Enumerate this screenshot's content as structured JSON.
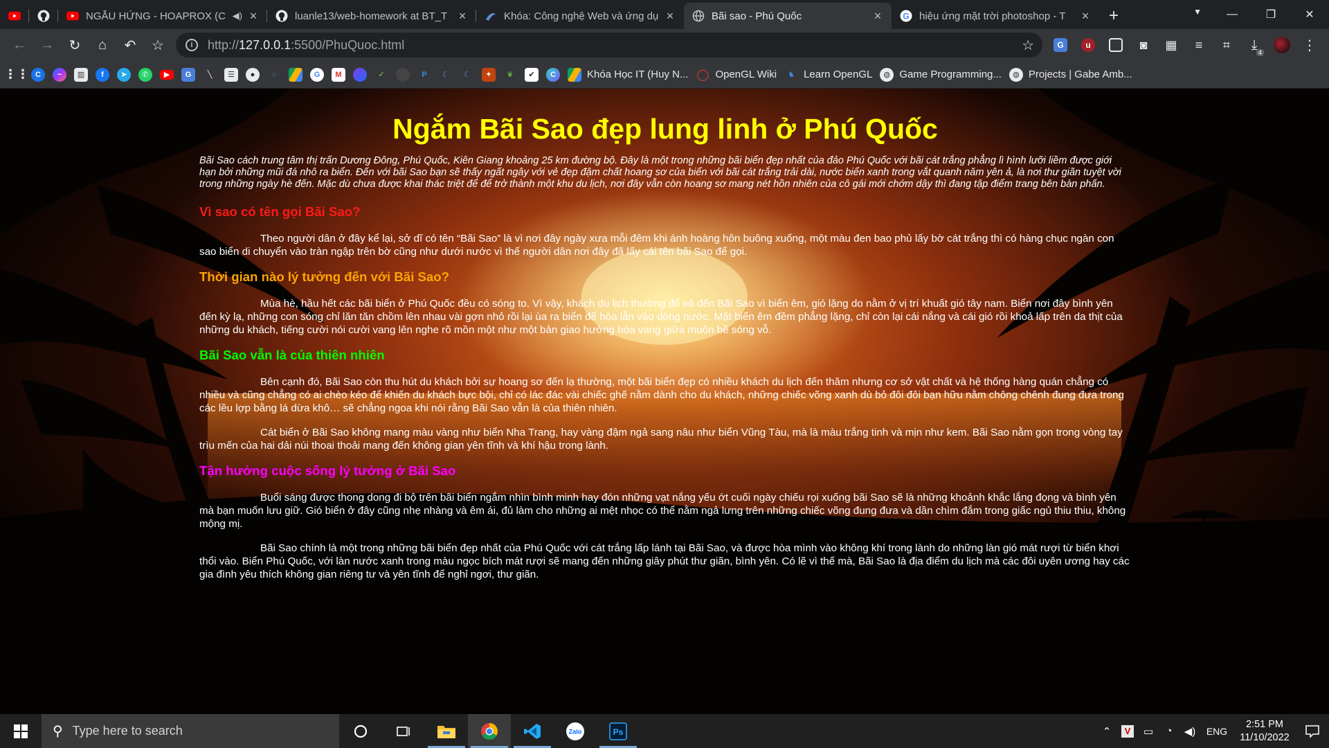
{
  "browser": {
    "tabs": [
      {
        "title": "",
        "icon": "youtube-icon",
        "pinned": true
      },
      {
        "title": "",
        "icon": "github-icon",
        "pinned": true
      },
      {
        "title": "NGẪU HỨNG - HOAPROX (C",
        "icon": "youtube-icon",
        "audio": "speaker-icon"
      },
      {
        "title": "luanle13/web-homework at BT_T",
        "icon": "github-icon"
      },
      {
        "title": "Khóa: Công nghệ Web và ứng dụ",
        "icon": "moodle-icon"
      },
      {
        "title": "Bãi sao - Phú Quốc",
        "icon": "globe-icon",
        "active": true
      },
      {
        "title": "hiệu ứng mặt trời photoshop - T",
        "icon": "google-icon"
      }
    ],
    "url_prefix": "http://",
    "url_host": "127.0.0.1",
    "url_rest": ":5500/PhuQuoc.html",
    "download_count": "4",
    "bookmarks": [
      {
        "label": "",
        "icon": "apps-grid-icon"
      },
      {
        "label": "",
        "icon": "c-icon"
      },
      {
        "label": "",
        "icon": "messenger-icon"
      },
      {
        "label": "",
        "icon": "trello-icon"
      },
      {
        "label": "",
        "icon": "facebook-icon"
      },
      {
        "label": "",
        "icon": "telegram-icon"
      },
      {
        "label": "",
        "icon": "whatsapp-icon"
      },
      {
        "label": "",
        "icon": "youtube-icon"
      },
      {
        "label": "",
        "icon": "translate-icon"
      },
      {
        "label": "",
        "icon": "pen-icon"
      },
      {
        "label": "",
        "icon": "stack-icon"
      },
      {
        "label": "",
        "icon": "github-icon"
      },
      {
        "label": "",
        "icon": "spinner-icon"
      },
      {
        "label": "",
        "icon": "drive-icon"
      },
      {
        "label": "",
        "icon": "google-icon"
      },
      {
        "label": "",
        "icon": "gmail-icon"
      },
      {
        "label": "",
        "icon": "orb-icon"
      },
      {
        "label": "",
        "icon": "chart-icon"
      },
      {
        "label": "",
        "icon": "circle-icon"
      },
      {
        "label": "",
        "icon": "paypal-icon"
      },
      {
        "label": "",
        "icon": "moodle-icon"
      },
      {
        "label": "",
        "icon": "moodle-icon"
      },
      {
        "label": "",
        "icon": "shield-icon"
      },
      {
        "label": "",
        "icon": "leaf-icon"
      },
      {
        "label": "",
        "icon": "check-icon"
      },
      {
        "label": "",
        "icon": "c-icon"
      },
      {
        "label": "Khóa Học IT (Huy N...",
        "icon": "drive-icon"
      },
      {
        "label": "OpenGL Wiki",
        "icon": "opengl-icon"
      },
      {
        "label": "Learn OpenGL",
        "icon": "learnopengl-icon"
      },
      {
        "label": "Game Programming...",
        "icon": "globe-icon"
      },
      {
        "label": "Projects | Gabe Amb...",
        "icon": "globe-icon"
      }
    ]
  },
  "page": {
    "title": "Ngắm Bãi Sao đẹp lung linh ở Phú Quốc",
    "intro": "Bãi Sao cách trung tâm thị trấn Dương Đông, Phú Quốc, Kiên Giang khoảng 25 km đường bộ. Đây là một trong những bãi biển đẹp nhất của đảo Phú Quốc với bãi cát trắng phẳng lì hình lưỡi liềm được giới hạn bởi những mũi đá nhô ra biển. Đến với bãi Sao bạn sẽ thấy ngất ngây với vẻ đẹp đậm chất hoang sơ của biển với bãi cát trắng trải dài, nước biển xanh trong vắt quanh năm yên ả, là nơi thư giãn tuyệt vời trong những ngày hè đến. Mặc dù chưa được khai thác triệt để để trở thành một khu du lịch, nơi đây vẫn còn hoang sơ mang nét hồn nhiên của cô gái mới chớm dậy thì đang tập điểm trang bên bàn phấn.",
    "sections": [
      {
        "heading": "Vì sao có tên gọi Bãi Sao?",
        "color": "#ff1a1a",
        "paragraphs": [
          "Theo người dân ở đây kể lại, sở dĩ có tên “Bãi Sao” là vì nơi đây ngày xưa mỗi đêm khi ánh hoàng hôn buông xuống, một màu đen bao phủ lấy bờ cát trắng thì có hàng chục ngàn con sao biển di chuyển vào tràn ngập trên bờ cũng như dưới nước vì thế người dân nơi đây đã lấy cái tên bãi Sao để gọi."
        ]
      },
      {
        "heading": "Thời gian nào lý tưởng đến với Bãi Sao?",
        "color": "#ffa500",
        "paragraphs": [
          "Mùa hè, hầu hết các bãi biển ở Phú Quốc đều có sóng to. Vì vậy, khách du lịch thường đổ xô đến Bãi Sao vì biển êm, gió lặng do nằm ở vị trí khuất gió tây nam. Biển nơi đây bình yên đến kỳ lạ, những con sóng chỉ lăn tăn chồm lên nhau vài gợn nhỏ rồi lại ùa ra biển để hòa lẫn vào dòng nước. Mặt biển êm đềm phẳng lặng, chỉ còn lại cái nắng và cái gió rồi khoả lấp trên da thịt của những du khách, tiếng cười nói cười vang lên nghe rõ mồn một như một bản giao hưởng hòa vang giữa muôn bề sóng vỗ."
        ]
      },
      {
        "heading": "Bãi Sao vẫn là của thiên nhiên",
        "color": "#00ff00",
        "paragraphs": [
          "Bên cạnh đó, Bãi Sao còn thu hút du khách bởi sự hoang sơ đến lạ thường, một bãi biển đẹp có nhiều khách du lịch đến thăm nhưng cơ sở vật chất và hệ thống hàng quán chẳng có nhiều và cũng chẳng có ai chèo kéo để khiến du khách bực bội, chỉ có lác đác vài chiếc ghế nằm dành cho du khách, những chiếc võng xanh dù bỏ đôi đôi bạn hữu nằm chông chênh đung đưa trong các lều lợp bằng lá dừa khô… sẽ chẳng ngoa khi nói rằng Bãi Sao vẫn là của thiên nhiên.",
          "Cát biển ở Bãi Sao không mang màu vàng như biển Nha Trang, hay vàng đậm ngả sang nâu như biển Vũng Tàu, mà là màu trắng tinh và mịn như kem. Bãi Sao nằm gọn trong vòng tay trìu mến của hai dải núi thoai thoải mang đến không gian yên tĩnh và khí hậu trong lành."
        ]
      },
      {
        "heading": "Tận hưởng cuộc sống lý tưởng ở Bãi Sao",
        "color": "#ff00ff",
        "paragraphs": [
          "Buổi sáng được thong dong đi bộ trên bãi biển ngắm nhìn bình minh hay đón những vạt nắng yếu ớt cuối ngày chiếu rọi xuống bãi Sao sẽ là những khoảnh khắc lắng đọng và bình yên mà bạn muốn lưu giữ. Gió biển ở đây cũng nhẹ nhàng và êm ái, đủ làm cho những ai mệt nhọc có thể nằm ngả lưng trên những chiếc võng đung đưa và dần chìm đắm trong giấc ngủ thiu thiu, không mộng mị.",
          "Bãi Sao chính là một trong những bãi biển đẹp nhất của Phú Quốc với cát trắng lấp lánh tại Bãi Sao, và được hòa mình vào không khí trong lành do những làn gió mát rượi từ biển khơi thổi vào. Biển Phú Quốc, với làn nước xanh trong màu ngọc bích mát rượi sẽ mang đến những giây phút thư giãn, bình yên. Có lẽ vì thế mà, Bãi Sao là địa điểm du lịch mà các đôi uyên ương hay các gia đình yêu thích không gian riêng tư và yên tĩnh để nghỉ ngơi, thư giãn."
        ]
      }
    ]
  },
  "taskbar": {
    "search_placeholder": "Type here to search",
    "language": "ENG",
    "time": "2:51 PM",
    "date": "11/10/2022"
  }
}
